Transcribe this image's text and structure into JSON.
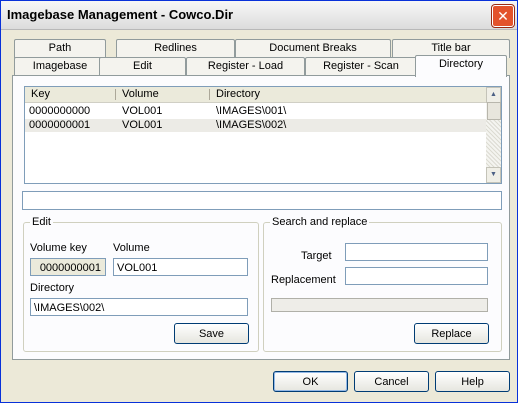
{
  "window": {
    "title": "Imagebase Management - Cowco.Dir",
    "close_glyph": "✕"
  },
  "tabs_back": [
    "Path",
    "Redlines",
    "Document Breaks",
    "Title bar"
  ],
  "tabs_front": [
    "Imagebase",
    "Edit",
    "Register - Load",
    "Register - Scan",
    "Directory"
  ],
  "active_tab": "Directory",
  "list": {
    "columns": [
      "Key",
      "Volume",
      "Directory"
    ],
    "rows": [
      [
        "0000000000",
        "VOL001",
        "\\IMAGES\\001\\"
      ],
      [
        "0000000001",
        "VOL001",
        "\\IMAGES\\002\\"
      ]
    ],
    "selected_row": 1
  },
  "status_field": "",
  "edit_group": {
    "title": "Edit",
    "volume_key_label": "Volume key",
    "volume_key_value": "0000000001",
    "volume_label": "Volume",
    "volume_value": "VOL001",
    "directory_label": "Directory",
    "directory_value": "\\IMAGES\\002\\",
    "save_label": "Save"
  },
  "search_group": {
    "title": "Search and replace",
    "target_label": "Target",
    "target_value": "",
    "replacement_label": "Replacement",
    "replacement_value": "",
    "progress": 0,
    "replace_label": "Replace"
  },
  "footer": {
    "ok_label": "OK",
    "cancel_label": "Cancel",
    "help_label": "Help"
  }
}
